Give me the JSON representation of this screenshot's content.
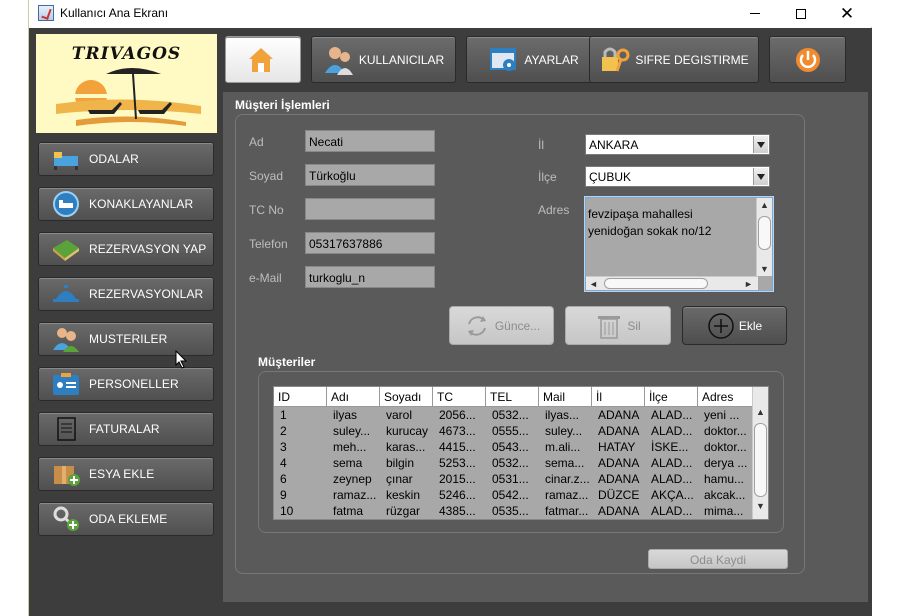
{
  "window": {
    "title": "Kullanıcı Ana Ekranı"
  },
  "logo": {
    "text": "TRIVAGOS"
  },
  "sidebar": {
    "items": [
      {
        "label": "ODALAR",
        "icon": "bed-icon"
      },
      {
        "label": "KONAKLAYANLAR",
        "icon": "guest-bed-icon"
      },
      {
        "label": "REZERVASYON YAP",
        "icon": "book-icon"
      },
      {
        "label": "REZERVASYONLAR",
        "icon": "service-bell-icon"
      },
      {
        "label": "MUSTERILER",
        "icon": "users-icon"
      },
      {
        "label": "PERSONELLER",
        "icon": "id-card-icon"
      },
      {
        "label": "FATURALAR",
        "icon": "invoice-icon"
      },
      {
        "label": "ESYA EKLE",
        "icon": "box-add-icon"
      },
      {
        "label": "ODA EKLEME",
        "icon": "key-add-icon"
      }
    ]
  },
  "topbar": {
    "home_label": "",
    "users_label": "KULLANICILAR",
    "settings_label": "AYARLAR",
    "password_label": "SIFRE DEGISTIRME",
    "power_label": ""
  },
  "form": {
    "section_title": "Müşteri İşlemleri",
    "labels": {
      "ad": "Ad",
      "soyad": "Soyad",
      "tc": "TC No",
      "telefon": "Telefon",
      "email": "e-Mail",
      "il": "İl",
      "ilce": "İlçe",
      "adres": "Adres"
    },
    "values": {
      "ad": "Necati",
      "soyad": "Türkoğlu",
      "tc": "",
      "telefon": "05317637886",
      "email": "turkoglu_n",
      "il": "ANKARA",
      "ilce": "ÇUBUK",
      "adres": "fevzipaşa mahallesi\nyenidoğan sokak no/12"
    },
    "buttons": {
      "guncelle": "Günce...",
      "sil": "Sil",
      "ekle": "Ekle"
    }
  },
  "table": {
    "section_title": "Müşteriler",
    "columns": [
      "ID",
      "Adı",
      "Soyadı",
      "TC",
      "TEL",
      "Mail",
      "İl",
      "İlçe",
      "Adres"
    ],
    "rows": [
      [
        "1",
        "ilyas",
        "varol",
        "2056...",
        "0532...",
        "ilyas...",
        "ADANA",
        "ALAD...",
        "yeni ..."
      ],
      [
        "2",
        "suley...",
        "kurucay",
        "4673...",
        "0555...",
        "suley...",
        "ADANA",
        "ALAD...",
        "doktor..."
      ],
      [
        "3",
        "meh...",
        "karas...",
        "4415...",
        "0543...",
        "m.ali...",
        "HATAY",
        "İSKE...",
        "doktor..."
      ],
      [
        "4",
        "sema",
        "bilgin",
        "5253...",
        "0532...",
        "sema...",
        "ADANA",
        "ALAD...",
        "derya ..."
      ],
      [
        "6",
        "zeynep",
        "çınar",
        "2015...",
        "0531...",
        "cinar.z...",
        "ADANA",
        "ALAD...",
        "hamu..."
      ],
      [
        "9",
        "ramaz...",
        "keskin",
        "5246...",
        "0542...",
        "ramaz...",
        "DÜZCE",
        "AKÇA...",
        "akcak..."
      ],
      [
        "10",
        "fatma",
        "rüzgar",
        "4385...",
        "0535...",
        "fatmar...",
        "ADANA",
        "ALAD...",
        "mima..."
      ]
    ]
  },
  "footer": {
    "oda_kaydi": "Oda Kaydi"
  }
}
